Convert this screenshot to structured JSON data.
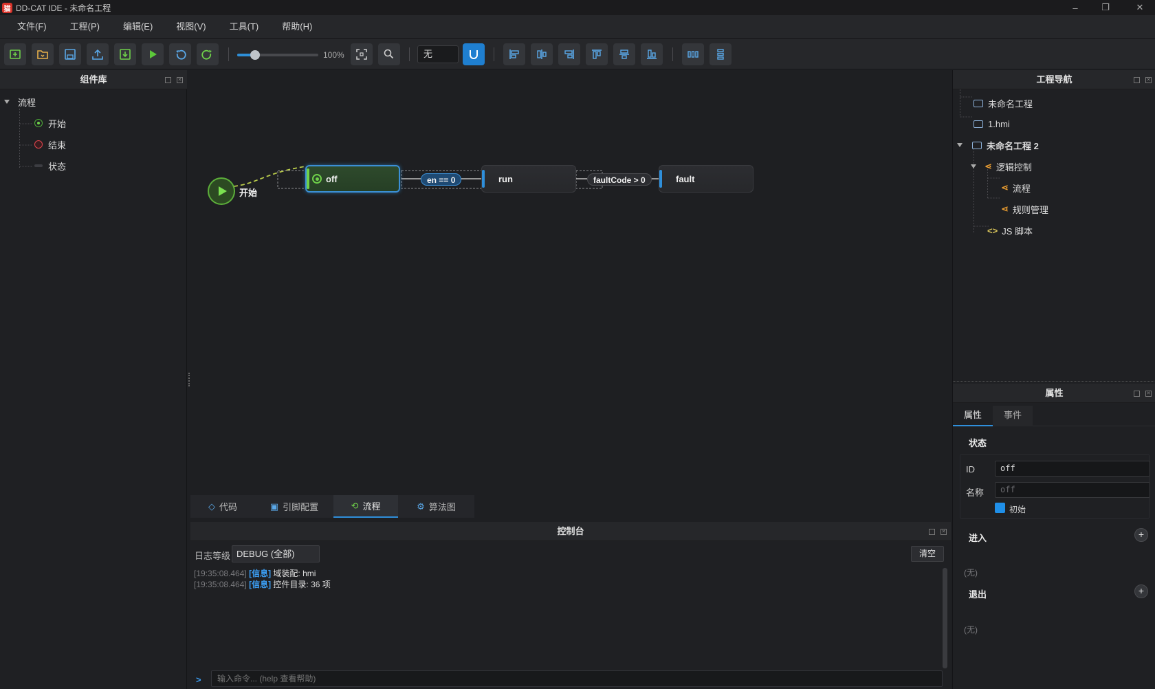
{
  "window": {
    "title": "DD-CAT IDE - 未命名工程",
    "app_icon": "猫"
  },
  "menu": [
    "文件(F)",
    "工程(P)",
    "编辑(E)",
    "视图(V)",
    "工具(T)",
    "帮助(H)"
  ],
  "toolbar": {
    "zoom": "100%",
    "grid_select": "无",
    "zoom_fraction": 0.22
  },
  "left_panel": {
    "title": "组件库",
    "tree": {
      "group": "流程",
      "items": [
        "开始",
        "结束",
        "状态"
      ]
    }
  },
  "flow": {
    "start_label": "开始",
    "states": [
      "off",
      "run",
      "fault"
    ],
    "transitions": [
      "en == 0",
      "faultCode > 0"
    ]
  },
  "editor_tabs": [
    "代码",
    "引脚配置",
    "流程",
    "算法图"
  ],
  "console": {
    "title": "控制台",
    "level_label": "日志等级",
    "level_value": "DEBUG (全部)",
    "clear_label": "清空",
    "logs": [
      {
        "time": "[19:35:08.464]",
        "tag": "[信息]",
        "msg": "域装配: hmi"
      },
      {
        "time": "[19:35:08.464]",
        "tag": "[信息]",
        "msg": "控件目录: 36 项"
      }
    ],
    "prompt": ">",
    "input_placeholder": "输入命令... (help 查看帮助)"
  },
  "project_nav": {
    "title": "工程导航",
    "items": [
      "未命名工程",
      "1.hmi",
      "未命名工程 2",
      "逻辑控制",
      "流程",
      "规则管理",
      "JS 脚本"
    ]
  },
  "properties": {
    "title": "属性",
    "tabs": [
      "属性",
      "事件"
    ],
    "section": "状态",
    "id_label": "ID",
    "id_value": "off",
    "name_label": "名称",
    "name_placeholder": "off",
    "initial_label": "初始",
    "enter_label": "进入",
    "enter_empty": "(无)",
    "exit_label": "退出",
    "exit_empty": "(无)"
  },
  "colors": {
    "accent": "#2f8fdb",
    "start_green": "#6fd14a",
    "end_red": "#e2454d"
  }
}
